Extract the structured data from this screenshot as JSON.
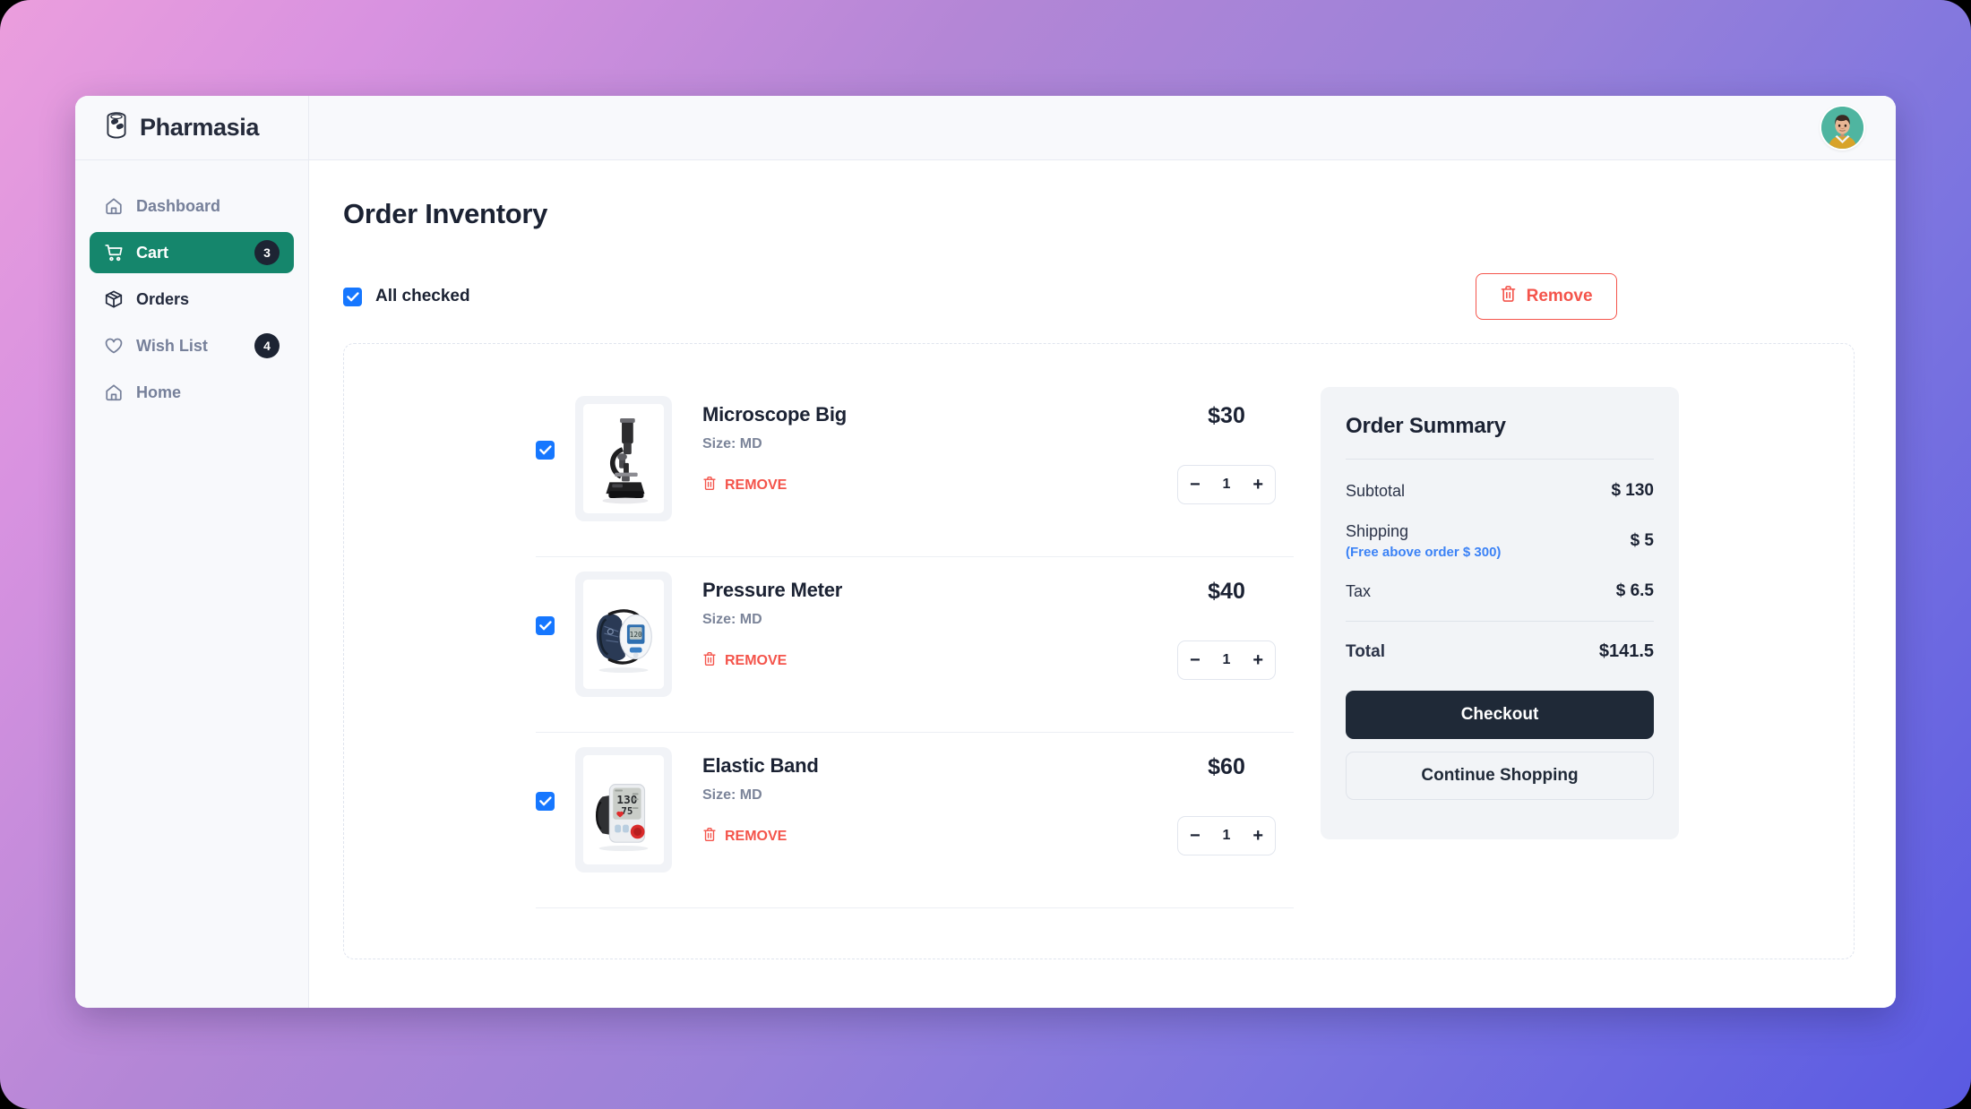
{
  "brand": {
    "name": "Pharmasia",
    "logo_icon": "pill-jar-icon"
  },
  "topbar": {
    "avatar_icon": "user-avatar"
  },
  "sidebar": {
    "items": [
      {
        "label": "Dashboard",
        "icon": "home-icon",
        "active": false,
        "badge": ""
      },
      {
        "label": "Cart",
        "icon": "shopping-cart-icon",
        "active": true,
        "badge": "3"
      },
      {
        "label": "Orders",
        "icon": "package-box-icon",
        "active": false,
        "badge": ""
      },
      {
        "label": "Wish List",
        "icon": "heart-icon",
        "active": false,
        "badge": "4"
      },
      {
        "label": "Home",
        "icon": "home-icon",
        "active": false,
        "badge": ""
      }
    ]
  },
  "main": {
    "page_title": "Order Inventory",
    "all_checked_label": "All checked",
    "all_checked": true,
    "remove_all_label": "Remove",
    "remove_all_icon": "trash-icon"
  },
  "cart": {
    "items": [
      {
        "name": "Microscope Big",
        "size_label": "Size: MD",
        "remove_label": "REMOVE",
        "price": "$30",
        "qty": "1",
        "checked": true,
        "image_icon": "microscope-image",
        "minus": "−",
        "plus": "+"
      },
      {
        "name": "Pressure Meter",
        "size_label": "Size: MD",
        "remove_label": "REMOVE",
        "price": "$40",
        "qty": "1",
        "checked": true,
        "image_icon": "blood-pressure-monitor-image",
        "minus": "−",
        "plus": "+"
      },
      {
        "name": "Elastic Band",
        "size_label": "Size: MD",
        "remove_label": "REMOVE",
        "price": "$60",
        "qty": "1",
        "checked": true,
        "image_icon": "wrist-blood-pressure-monitor-image",
        "minus": "−",
        "plus": "+"
      }
    ]
  },
  "summary": {
    "title": "Order Summary",
    "subtotal_label": "Subtotal",
    "subtotal_value": "$ 130",
    "shipping_label": "Shipping",
    "shipping_note": "(Free above order $ 300)",
    "shipping_value": "$ 5",
    "tax_label": "Tax",
    "tax_value": "$ 6.5",
    "total_label": "Total",
    "total_value": "$141.5",
    "checkout_label": "Checkout",
    "continue_label": "Continue Shopping"
  },
  "colors": {
    "accent_green": "#15866c",
    "danger_red": "#f4544b",
    "checkbox_blue": "#1677ff",
    "link_blue": "#3b82f6",
    "dark_navy": "#1f2937"
  }
}
